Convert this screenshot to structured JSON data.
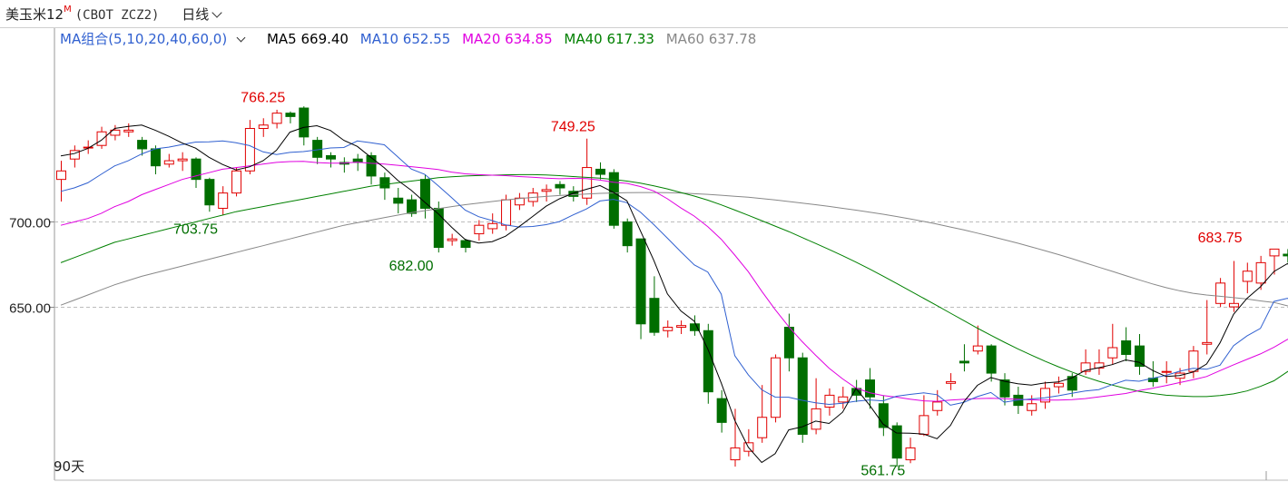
{
  "header": {
    "name": "美玉米12",
    "sup": "M",
    "code": "(CBOT ZCZ2)",
    "period": "日线"
  },
  "legend": {
    "group": "MA组合(5,10,20,40,60,0)",
    "ma5": "MA5 669.40",
    "ma10": "MA10 652.55",
    "ma20": "MA20 634.85",
    "ma40": "MA40 617.33",
    "ma60": "MA60 637.78"
  },
  "footer": {
    "days": "90天"
  },
  "colors": {
    "up": "#e00000",
    "down": "#006e00",
    "ma5": "#000000",
    "ma10": "#3060d0",
    "ma20": "#e000e0",
    "ma40": "#008000",
    "ma60": "#888888",
    "legend_group": "#3060d0"
  },
  "chart_data": {
    "type": "candlestick",
    "y_ticks": [
      "700.00",
      "650.00"
    ],
    "y_tick_values": [
      700,
      650
    ],
    "ylim": [
      548,
      798
    ],
    "grid": "horizontal-dashed",
    "annotations": [
      {
        "text": "766.25",
        "index": 15,
        "value": 766.25,
        "kind": "high"
      },
      {
        "text": "749.25",
        "index": 38,
        "value": 749.25,
        "kind": "high"
      },
      {
        "text": "703.75",
        "index": 10,
        "value": 703.75,
        "kind": "low"
      },
      {
        "text": "682.00",
        "index": 26,
        "value": 682.0,
        "kind": "low"
      },
      {
        "text": "561.75",
        "index": 61,
        "value": 561.75,
        "kind": "low"
      },
      {
        "text": "683.75",
        "index": 86,
        "value": 683.75,
        "kind": "high"
      }
    ],
    "candles": [
      [
        725,
        730,
        736,
        712
      ],
      [
        737,
        742,
        745,
        732
      ],
      [
        744,
        744,
        748,
        740
      ],
      [
        745,
        753,
        756,
        743
      ],
      [
        751,
        754,
        757,
        748
      ],
      [
        753,
        754,
        758,
        750
      ],
      [
        748,
        743,
        750,
        739
      ],
      [
        743,
        733,
        745,
        728
      ],
      [
        734,
        736,
        740,
        732
      ],
      [
        736,
        737,
        741,
        730
      ],
      [
        737,
        725,
        738,
        720
      ],
      [
        725,
        710,
        726,
        706
      ],
      [
        708,
        717,
        721,
        704
      ],
      [
        717,
        730,
        732,
        715
      ],
      [
        730,
        755,
        760,
        728
      ],
      [
        755,
        757,
        761,
        750
      ],
      [
        758,
        764,
        766,
        755
      ],
      [
        764,
        762,
        765,
        758
      ],
      [
        767,
        750,
        768,
        745
      ],
      [
        748,
        738,
        750,
        734
      ],
      [
        739,
        737,
        741,
        732
      ],
      [
        735,
        734,
        738,
        729
      ],
      [
        737,
        735,
        740,
        730
      ],
      [
        739,
        727,
        741,
        722
      ],
      [
        726,
        720,
        729,
        713
      ],
      [
        714,
        711,
        720,
        705
      ],
      [
        713,
        705,
        716,
        703
      ],
      [
        725,
        708,
        728,
        702
      ],
      [
        708,
        685,
        712,
        682
      ],
      [
        689,
        690,
        693,
        686
      ],
      [
        689,
        685,
        690,
        682
      ],
      [
        693,
        698,
        701,
        689
      ],
      [
        696,
        699,
        705,
        693
      ],
      [
        698,
        713,
        716,
        695
      ],
      [
        710,
        714,
        717,
        707
      ],
      [
        712,
        717,
        720,
        709
      ],
      [
        718,
        719,
        722,
        712
      ],
      [
        722,
        720,
        724,
        716
      ],
      [
        718,
        715,
        721,
        712
      ],
      [
        714,
        732,
        749,
        710
      ],
      [
        731,
        728,
        735,
        725
      ],
      [
        729,
        698,
        731,
        696
      ],
      [
        700,
        686,
        702,
        682
      ],
      [
        690,
        640,
        690,
        631
      ],
      [
        655,
        635,
        668,
        633
      ],
      [
        636,
        638,
        642,
        632
      ],
      [
        638,
        639,
        642,
        634
      ],
      [
        640,
        636,
        645,
        633
      ],
      [
        636,
        600,
        640,
        593
      ],
      [
        596,
        582,
        601,
        576
      ],
      [
        560,
        567,
        590,
        556
      ],
      [
        565,
        570,
        578,
        562
      ],
      [
        573,
        585,
        604,
        570
      ],
      [
        585,
        620,
        622,
        582
      ],
      [
        638,
        620,
        646,
        612
      ],
      [
        620,
        575,
        623,
        570
      ],
      [
        578,
        590,
        608,
        575
      ],
      [
        591,
        598,
        602,
        586
      ],
      [
        594,
        597,
        603,
        590
      ],
      [
        602,
        598,
        607,
        594
      ],
      [
        607,
        597,
        614,
        590
      ],
      [
        593,
        579,
        598,
        574
      ],
      [
        580,
        561,
        582,
        556
      ],
      [
        560,
        567,
        573,
        558
      ],
      [
        575,
        586,
        598,
        574
      ],
      [
        589,
        594,
        601,
        586
      ],
      [
        605,
        606,
        611,
        601
      ],
      [
        618,
        617,
        628,
        612
      ],
      [
        624,
        627,
        639,
        622
      ],
      [
        627,
        611,
        628,
        606
      ],
      [
        607,
        597,
        611,
        592
      ],
      [
        598,
        592,
        603,
        587
      ],
      [
        589,
        593,
        598,
        586
      ],
      [
        594,
        602,
        606,
        590
      ],
      [
        603,
        605,
        609,
        599
      ],
      [
        609,
        601,
        611,
        597
      ],
      [
        612,
        617,
        625,
        610
      ],
      [
        614,
        617,
        625,
        610
      ],
      [
        620,
        626,
        640,
        616
      ],
      [
        630,
        622,
        638,
        618
      ],
      [
        627,
        615,
        634,
        610
      ],
      [
        608,
        606,
        618,
        603
      ],
      [
        612,
        612,
        618,
        605
      ],
      [
        608,
        611,
        614,
        604
      ],
      [
        612,
        624,
        627,
        608
      ],
      [
        628,
        629,
        654,
        622
      ],
      [
        652,
        664,
        667,
        650
      ],
      [
        650,
        652,
        677,
        647
      ],
      [
        665,
        671,
        676,
        658
      ],
      [
        664,
        676,
        680,
        660
      ],
      [
        680,
        684,
        684,
        669
      ],
      [
        681,
        680,
        684,
        676
      ],
      [
        678,
        674,
        682,
        670
      ]
    ],
    "ma5": [
      738.8,
      740.2,
      743.2,
      748,
      755,
      756.2,
      757,
      754,
      750.4,
      746.4,
      743.4,
      738,
      733.8,
      730.6,
      732.4,
      736,
      742.2,
      752.8,
      755.6,
      756.6,
      753.8,
      748,
      744.4,
      738,
      731.8,
      724.4,
      718.6,
      711.6,
      704.8,
      696.8,
      689.6,
      687.6,
      688.4,
      691.6,
      697.2,
      703.2,
      709.2,
      713.6,
      716.8,
      719.2,
      721.4,
      717.4,
      712.4,
      694.8,
      677.2,
      657.6,
      647.6,
      641.6,
      625.2,
      605.2,
      583.2,
      567.4,
      558.4,
      563.6,
      577.6,
      579.4,
      582.8,
      581.4,
      588,
      602,
      592.2,
      581,
      575.8,
      575.6,
      575.2,
      572.4,
      580.2,
      594.2,
      603.8,
      608.4,
      606.2,
      604.8,
      604,
      605.2,
      605.8,
      608.2,
      612.6,
      614.2,
      616,
      618.8,
      617.4,
      612.6,
      609,
      609.6,
      611.6,
      616.4,
      628.8,
      645.6,
      655,
      661.8,
      670.8,
      675.4,
      669.4
    ],
    "ma10": [
      718,
      720,
      723,
      728,
      733,
      736,
      740,
      743,
      744,
      745.5,
      747,
      747.1,
      747.6,
      746.6,
      744.9,
      741.2,
      739.6,
      740.9,
      741.4,
      742.4,
      743.5,
      743.8,
      747.6,
      746.6,
      745.4,
      738.2,
      731.1,
      728,
      721.3,
      714.3,
      706.9,
      703.1,
      700.8,
      698.2,
      697,
      697.3,
      698.4,
      700.2,
      704.1,
      707.6,
      712.3,
      713.3,
      711.3,
      705.8,
      698.4,
      690.4,
      682.4,
      674.7,
      670.5,
      657.5,
      621.3,
      610,
      601.2,
      596.9,
      596.8,
      595,
      593.5,
      592.6,
      593.3,
      594.5,
      595.2,
      594.7,
      597.4,
      598.5,
      599.4,
      598.3,
      592.1,
      593.8,
      597.2,
      599.6,
      593.9,
      595.1,
      595.8,
      596.5,
      597.7,
      599.1,
      600.5,
      601.3,
      604.2,
      606.8,
      606.2,
      608,
      609.7,
      612.1,
      613.8,
      613.3,
      615.7,
      627.1,
      632.9,
      637.3,
      653.2,
      655,
      652.55
    ],
    "ma20": [
      698,
      700,
      702,
      705,
      709,
      712,
      716,
      719,
      722,
      725,
      727,
      729,
      731,
      732,
      733,
      734,
      735,
      735.5,
      735.6,
      734.9,
      734.6,
      734.6,
      735.2,
      734.5,
      734,
      733.3,
      732.5,
      731.7,
      730.8,
      729.3,
      728.3,
      727.8,
      727.5,
      727.2,
      726.7,
      726.3,
      725.8,
      725.4,
      725.6,
      725.5,
      724.6,
      723.4,
      722.7,
      720.8,
      718.2,
      713.6,
      708.2,
      703.4,
      697.2,
      689.8,
      680.5,
      670.7,
      659.2,
      648.4,
      638.4,
      629.5,
      621.5,
      613.9,
      607.6,
      602.2,
      599.5,
      597.8,
      596.9,
      595.7,
      594.7,
      594.4,
      595.1,
      595.6,
      596,
      596.2,
      595.9,
      595.6,
      595.3,
      595.1,
      595.1,
      595.4,
      596,
      597,
      598,
      599,
      600.8,
      602.1,
      603.7,
      605.4,
      607.1,
      609,
      612.5,
      615.9,
      619.1,
      622.3,
      626.2,
      630.8,
      634.85
    ],
    "ma40": [
      676,
      679,
      682,
      685,
      688,
      690,
      692,
      694,
      696,
      698,
      700,
      702,
      704,
      706,
      707.5,
      709,
      710.5,
      712,
      713.5,
      715,
      716.5,
      718,
      719.5,
      721,
      722,
      723,
      724,
      725,
      726,
      726.6,
      727,
      727.3,
      727.5,
      727.7,
      727.8,
      727.8,
      727.6,
      727.2,
      726.7,
      726.2,
      725.7,
      724.9,
      724,
      722.8,
      721.2,
      719.4,
      717.3,
      715.2,
      712.8,
      710,
      707,
      703.9,
      700.7,
      697.5,
      694.3,
      690.8,
      687.3,
      683.8,
      680.1,
      676.3,
      672.3,
      668.1,
      663.8,
      659.5,
      655.1,
      650.7,
      646.3,
      641.9,
      637.5,
      633.3,
      629.2,
      625.3,
      621.6,
      618.1,
      614.8,
      611.7,
      608.8,
      606.2,
      604,
      602,
      600.3,
      599,
      598,
      597.5,
      597.2,
      597.2,
      597.8,
      598.8,
      600.5,
      603.2,
      606.5,
      611.8,
      617.33
    ],
    "ma60": [
      651,
      654,
      657,
      660,
      663,
      665.5,
      668,
      670,
      672,
      674,
      676,
      678,
      680,
      682,
      684,
      686,
      688,
      690,
      692,
      694,
      696,
      698,
      699.5,
      701,
      702.5,
      704,
      705.4,
      706.6,
      707.8,
      709,
      710.1,
      711.1,
      712,
      712.9,
      713.7,
      714.4,
      715,
      715.5,
      716,
      716.4,
      716.8,
      717,
      717.2,
      717.3,
      717.3,
      717.2,
      717,
      716.6,
      716.2,
      715.7,
      715.1,
      714.5,
      713.7,
      712.9,
      712,
      711.1,
      710.1,
      709.1,
      708,
      706.9,
      705.7,
      704.5,
      703.2,
      701.8,
      700.3,
      698.7,
      697,
      695.3,
      693.4,
      691.5,
      689.5,
      687.5,
      685.3,
      683.1,
      680.8,
      678.4,
      675.9,
      673.4,
      670.9,
      668.4,
      665.9,
      663.5,
      661.3,
      659.5,
      658,
      657,
      656.2,
      655.4,
      654.6,
      653.5,
      652.6,
      650.6,
      649.7
    ]
  }
}
